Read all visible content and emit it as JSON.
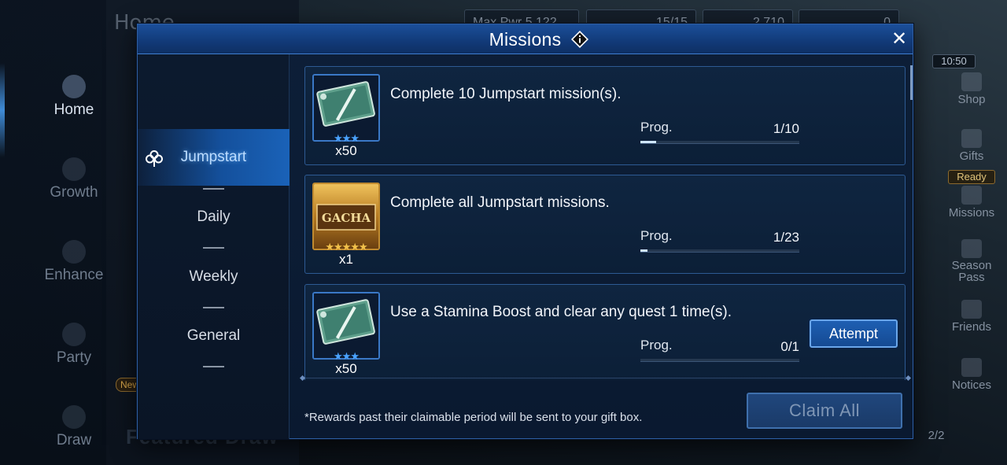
{
  "background": {
    "screen_title": "Home",
    "left_nav": [
      {
        "label": "Home",
        "icon": "home-icon"
      },
      {
        "label": "Growth",
        "icon": "growth-icon"
      },
      {
        "label": "Enhance",
        "icon": "enhance-icon"
      },
      {
        "label": "Party",
        "icon": "party-icon"
      },
      {
        "label": "Draw",
        "icon": "draw-icon"
      }
    ],
    "new_badge": "New",
    "featured_label": "Featured Draw",
    "top_bar": {
      "max_pwr_label": "Max Pwr",
      "max_pwr_value": "5,122",
      "stamina_value": "15/15",
      "crystals_value": "2,710",
      "gems_value": "0"
    },
    "time": "10:50",
    "ready_badge": "Ready",
    "right_nav": [
      {
        "label": "Shop",
        "icon": "cart-icon"
      },
      {
        "label": "Gifts",
        "icon": "gift-icon"
      },
      {
        "label": "Missions",
        "icon": "missions-icon"
      },
      {
        "label": "Season Pass",
        "icon": "season-pass-icon"
      },
      {
        "label": "Friends",
        "icon": "friends-icon"
      },
      {
        "label": "Notices",
        "icon": "mail-icon"
      }
    ],
    "pages": "2/2"
  },
  "modal": {
    "title": "Missions",
    "close_symbol": "✕",
    "tabs": [
      {
        "label": "Jumpstart",
        "active": true
      },
      {
        "label": "Daily",
        "active": false
      },
      {
        "label": "Weekly",
        "active": false
      },
      {
        "label": "General",
        "active": false
      }
    ],
    "progress_label": "Prog.",
    "missions": [
      {
        "description": "Complete 10 Jumpstart mission(s).",
        "reward_qty": "x50",
        "reward_icon": "weapon-ticket-icon",
        "reward_stars": "★★★",
        "progress": "1/10",
        "progress_fraction": 0.1
      },
      {
        "description": "Complete all Jumpstart missions.",
        "reward_qty": "x1",
        "reward_icon": "gacha-ticket-icon",
        "reward_text": "GACHA",
        "reward_stars": "★★★★★",
        "progress": "1/23",
        "progress_fraction": 0.0435
      },
      {
        "description": "Use a Stamina Boost and clear any quest 1 time(s).",
        "reward_qty": "x50",
        "reward_icon": "weapon-ticket-icon",
        "reward_stars": "★★★",
        "progress": "0/1",
        "progress_fraction": 0,
        "action_label": "Attempt"
      }
    ],
    "footnote": "*Rewards past their claimable period will be sent to your gift box.",
    "claim_all_label": "Claim All"
  },
  "colors": {
    "accent_blue": "#1a62b8",
    "star_blue": "#4aa3ff",
    "star_gold": "#f2c14a"
  }
}
